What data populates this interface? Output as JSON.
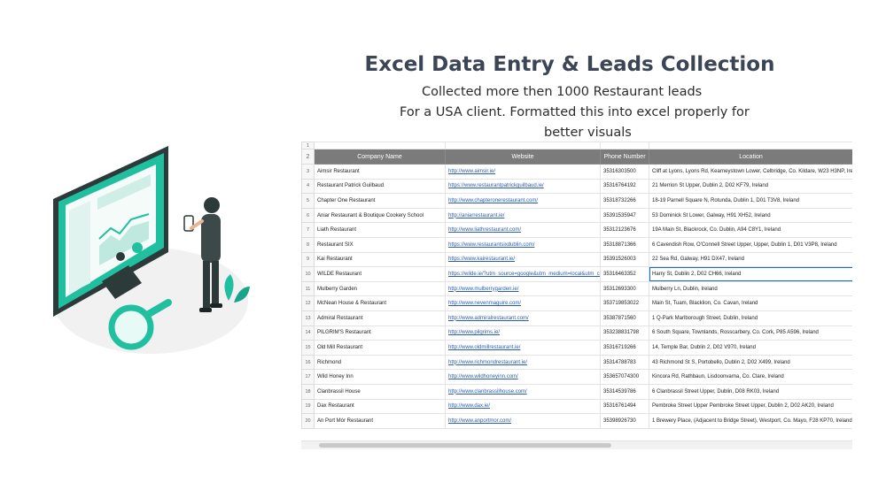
{
  "headline": {
    "title": "Excel Data Entry & Leads Collection",
    "line1": "Collected more then 1000 Restaurant leads",
    "line2": "For a USA client. Formatted this into excel properly for",
    "line3": "better visuals"
  },
  "colors": {
    "teal": "#1fbf9f",
    "dark": "#2f3d3b",
    "header_gray": "#7b7b7b",
    "link": "#2a5db0"
  },
  "sheet": {
    "first_row_number": "1",
    "header_row_number": "2",
    "columns": [
      "Company Name",
      "Website",
      "Phone Number",
      "Location"
    ],
    "rows": [
      {
        "n": "3",
        "company": "Aimsir Restaurant",
        "website": "http://www.aimsir.ie/",
        "phone": "35316303500",
        "location": "Cliff at Lyons, Lyons Rd, Kearneystown Lower, Celbridge, Co. Kildare, W23 H3NP, Ireland"
      },
      {
        "n": "4",
        "company": "Restaurant Patrick Guilbaud",
        "website": "https://www.restaurantpatrickguilbaud.ie/",
        "phone": "35316764192",
        "location": "21 Merrion St Upper, Dublin 2, D02 KF79, Ireland"
      },
      {
        "n": "5",
        "company": "Chapter One Restaurant",
        "website": "http://www.chapteronerestaurant.com/",
        "phone": "35318732266",
        "location": "18-19 Parnell Square N, Rotunda, Dublin 1, D01 T3V8, Ireland"
      },
      {
        "n": "6",
        "company": "Aniar Restaurant & Boutique Cookery School",
        "website": "http://aniarrestaurant.ie/",
        "phone": "35391535947",
        "location": "53 Dominick St Lower, Galway, H91 XH52, Ireland"
      },
      {
        "n": "7",
        "company": "Liath Restaurant",
        "website": "http://www.liathrestaurant.com/",
        "phone": "35312123676",
        "location": "19A Main St, Blackrock, Co. Dublin, A94 C8Y1, Ireland"
      },
      {
        "n": "8",
        "company": "Restaurant SIX",
        "website": "https://www.restaurantsixdublin.com/",
        "phone": "35318871366",
        "location": "6 Cavendish Row, O'Connell Street Upper, Upper, Dublin 1, D01 V3P8, Ireland"
      },
      {
        "n": "9",
        "company": "Kai Restaurant",
        "website": "https://www.kairestaurant.ie/",
        "phone": "35391526003",
        "location": "22 Sea Rd, Galway, H91 DX47, Ireland"
      },
      {
        "n": "10",
        "company": "WILDE Restaurant",
        "website": "https://wilde.ie/?utm_source=google&utm_medium=local&utm_campaign",
        "phone": "35316463352",
        "location": "Harry St, Dublin 2, D02 CH66, Ireland"
      },
      {
        "n": "11",
        "company": "Mulberry Garden",
        "website": "http://www.mulberrygarden.ie/",
        "phone": "35312693300",
        "location": "Mulberry Ln, Dublin, Ireland"
      },
      {
        "n": "12",
        "company": "McNean House & Restaurant",
        "website": "http://www.nevenmaguire.com/",
        "phone": "353719853022",
        "location": "Main St, Tuam, Blacklion, Co. Cavan, Ireland"
      },
      {
        "n": "13",
        "company": "Admiral Restaurant",
        "website": "http://www.admiralrestaurant.com/",
        "phone": "35387871560",
        "location": "1 Q-Park Marlborough Street, Dublin, Ireland"
      },
      {
        "n": "14",
        "company": "PILGRIM'S Restaurant",
        "website": "http://www.pilgrims.ie/",
        "phone": "353238831798",
        "location": "6 South Square, Townlands, Rosscarbery, Co. Cork, P85 A596, Ireland"
      },
      {
        "n": "15",
        "company": "Old Mill Restaurant",
        "website": "http://www.oldmillrestaurant.ie/",
        "phone": "35316719266",
        "location": "14, Temple Bar, Dublin 2, D02 V970, Ireland"
      },
      {
        "n": "16",
        "company": "Richmond",
        "website": "http://www.richmondrestaurant.ie/",
        "phone": "35314788783",
        "location": "43 Richmond St S, Portobello, Dublin 2, D02 X499, Ireland"
      },
      {
        "n": "17",
        "company": "Wild Honey Inn",
        "website": "http://www.wildhoneyinn.com/",
        "phone": "353657074300",
        "location": "Kincora Rd, Rathbaun, Lisdoonvarna, Co. Clare, Ireland"
      },
      {
        "n": "18",
        "company": "Clanbrassil House",
        "website": "http://www.clanbrassilhouse.com/",
        "phone": "35314539786",
        "location": "6 Clanbrassil Street Upper, Dublin, D08 RK03, Ireland"
      },
      {
        "n": "19",
        "company": "Dax Restaurant",
        "website": "http://www.dax.ie/",
        "phone": "35316761494",
        "location": "Pembroke Street Upper Pembroke Street Upper, Dublin 2, D02 AK20, Ireland"
      },
      {
        "n": "20",
        "company": "An Port Mór Restaurant",
        "website": "http://www.anportmor.com/",
        "phone": "35398926730",
        "location": "1 Brewery Place, (Adjacent to Bridge Street), Westport, Co. Mayo, F28 KP70, Ireland"
      }
    ]
  }
}
